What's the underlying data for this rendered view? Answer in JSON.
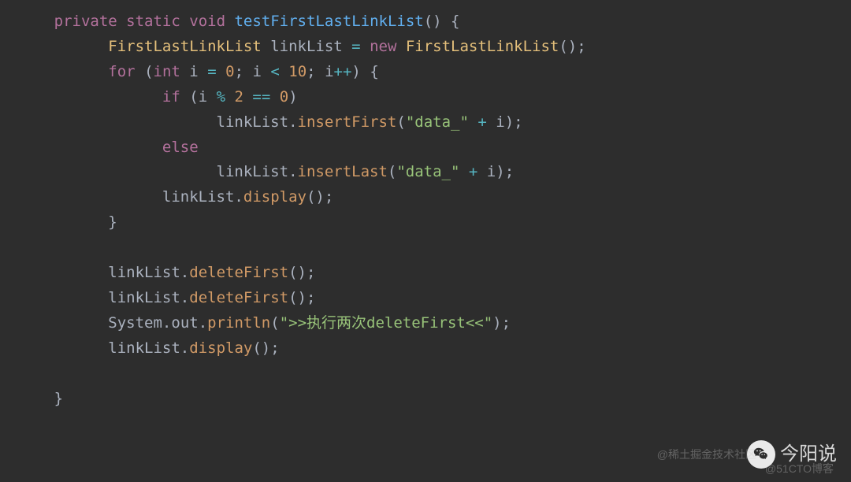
{
  "code": {
    "line1": {
      "kw_private": "private",
      "kw_static": "static",
      "kw_void": "void",
      "method": "testFirstLastLinkList",
      "parens": "()",
      "brace": "{"
    },
    "line2": {
      "type1": "FirstLastLinkList",
      "var": "linkList",
      "op": "=",
      "kw_new": "new",
      "type2": "FirstLastLinkList",
      "parens": "()",
      "semi": ";"
    },
    "line3": {
      "kw_for": "for",
      "lparen": "(",
      "type_int": "int",
      "var_i": "i",
      "op_eq": "=",
      "num0": "0",
      "semi1": ";",
      "var_i2": "i",
      "op_lt": "<",
      "num10": "10",
      "semi2": ";",
      "var_i3": "i",
      "op_inc": "++",
      "rparen": ")",
      "brace": "{"
    },
    "line4": {
      "kw_if": "if",
      "lparen": "(",
      "var_i": "i",
      "op_mod": "%",
      "num2": "2",
      "op_eq": "==",
      "num0": "0",
      "rparen": ")"
    },
    "line5": {
      "var": "linkList",
      "method": "insertFirst",
      "lparen": "(",
      "str": "\"data_\"",
      "op_plus": "+",
      "var_i": "i",
      "rparen": ")",
      "semi": ";"
    },
    "line6": {
      "kw_else": "else"
    },
    "line7": {
      "var": "linkList",
      "method": "insertLast",
      "lparen": "(",
      "str": "\"data_\"",
      "op_plus": "+",
      "var_i": "i",
      "rparen": ")",
      "semi": ";"
    },
    "line8": {
      "var": "linkList",
      "method": "display",
      "parens": "()",
      "semi": ";"
    },
    "line9": {
      "brace": "}"
    },
    "line11": {
      "var": "linkList",
      "method": "deleteFirst",
      "parens": "()",
      "semi": ";"
    },
    "line12": {
      "var": "linkList",
      "method": "deleteFirst",
      "parens": "()",
      "semi": ";"
    },
    "line13": {
      "var_sys": "System",
      "var_out": "out",
      "method": "println",
      "lparen": "(",
      "str": "\">>执行两次deleteFirst<<\"",
      "rparen": ")",
      "semi": ";"
    },
    "line14": {
      "var": "linkList",
      "method": "display",
      "parens": "()",
      "semi": ";"
    },
    "line16": {
      "brace": "}"
    }
  },
  "watermarks": {
    "main": "今阳说",
    "sub1": "@稀土掘金技术社区",
    "sub2": "@51CTO博客"
  }
}
